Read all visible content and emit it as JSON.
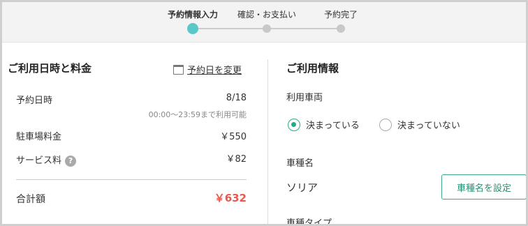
{
  "stepper": {
    "steps": [
      {
        "label": "予約情報入力",
        "active": true
      },
      {
        "label": "確認・お支払い",
        "active": false
      },
      {
        "label": "予約完了",
        "active": false
      }
    ]
  },
  "left": {
    "title": "ご利用日時と料金",
    "change_link": "予約日を変更",
    "rows": {
      "date_label": "予約日時",
      "date_value": "8/18",
      "date_sub": "00:00〜23:59まで利用可能",
      "parking_label": "駐車場料金",
      "parking_value": "￥550",
      "service_label": "サービス料",
      "service_help": "?",
      "service_value": "￥82",
      "total_label": "合計額",
      "total_value": "￥632"
    }
  },
  "right": {
    "title": "ご利用情報",
    "vehicle_label": "利用車両",
    "radio_options": [
      {
        "label": "決まっている",
        "checked": true
      },
      {
        "label": "決まっていない",
        "checked": false
      }
    ],
    "car_name_label": "車種名",
    "car_name_value": "ソリア",
    "set_button": "車種名を設定",
    "car_type_label": "車種タイプ"
  },
  "colors": {
    "accent_teal": "#5bc8c8",
    "button_green": "#3aa88a",
    "total_red": "#e8584f"
  }
}
